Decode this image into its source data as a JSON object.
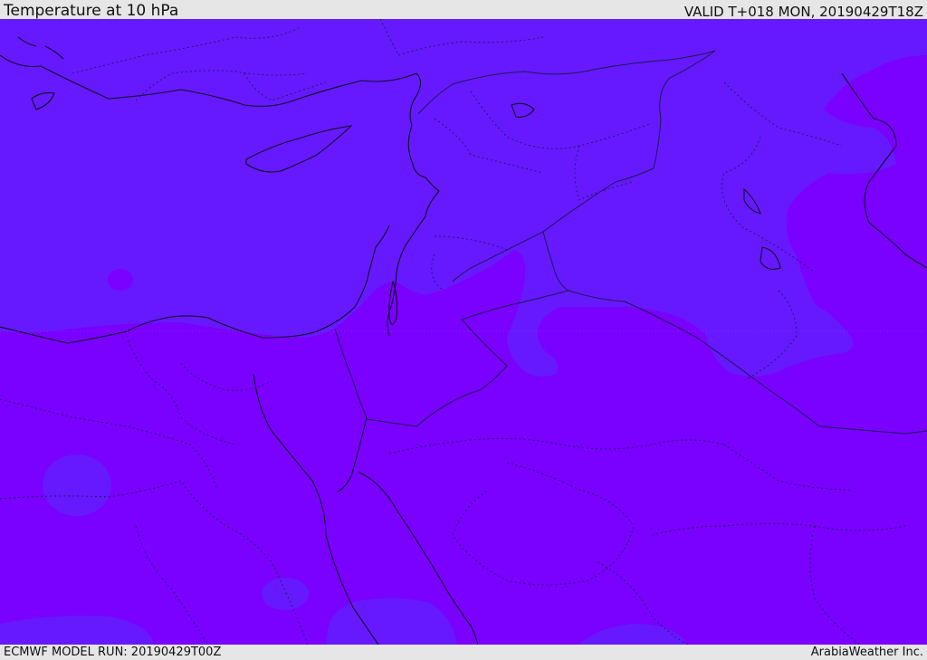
{
  "header": {
    "title": "Temperature at 10 hPa",
    "valid": "VALID T+018 MON, 20190429T18Z"
  },
  "footer": {
    "model_run": "ECMWF MODEL RUN: 20190429T00Z",
    "credit": "ArabiaWeather Inc."
  },
  "map": {
    "colors": {
      "cold_field": "#6619ff",
      "warm_field": "#7a00ff",
      "coastline": "#101028",
      "border": "#1a1a55"
    }
  }
}
